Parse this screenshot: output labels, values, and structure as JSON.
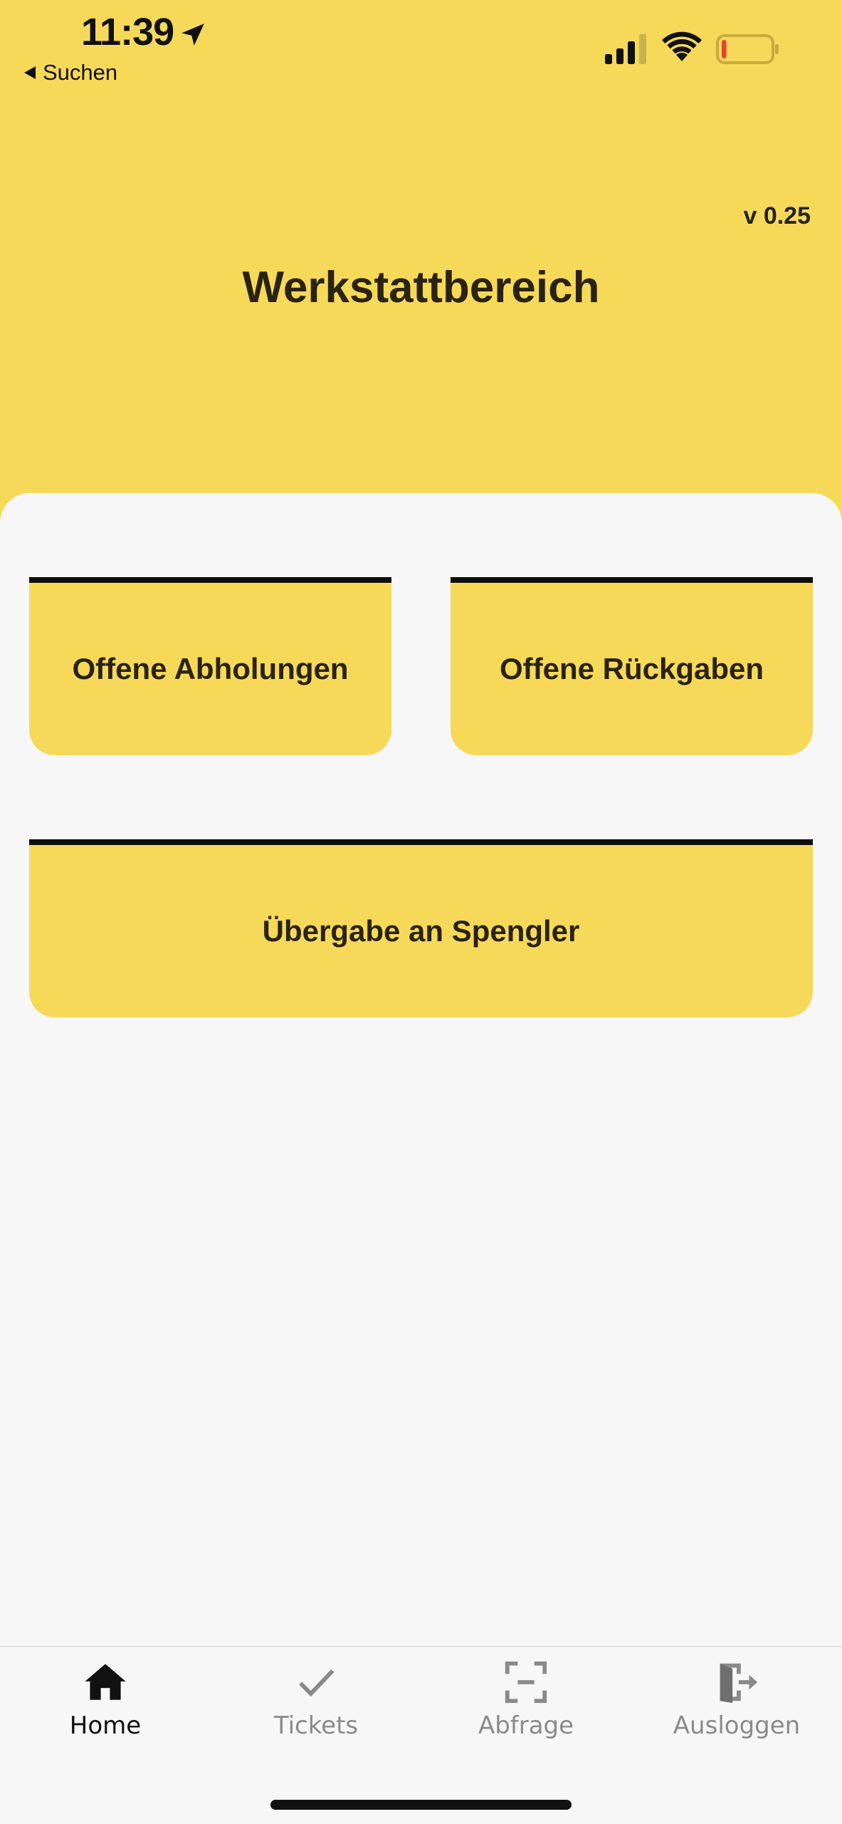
{
  "status_bar": {
    "time": "11:39",
    "back_label": "Suchen",
    "battery_level": 0.1
  },
  "header": {
    "version": "v 0.25",
    "title": "Werkstattbereich"
  },
  "tiles": [
    {
      "label": "Offene Abholungen"
    },
    {
      "label": "Offene Rückgaben"
    },
    {
      "label": "Übergabe an Spengler"
    }
  ],
  "tab_bar": {
    "tabs": [
      {
        "label": "Home",
        "icon": "home-icon",
        "active": true
      },
      {
        "label": "Tickets",
        "icon": "check-icon",
        "active": false
      },
      {
        "label": "Abfrage",
        "icon": "scan-icon",
        "active": false
      },
      {
        "label": "Ausloggen",
        "icon": "logout-icon",
        "active": false
      }
    ]
  },
  "colors": {
    "accent": "#f7d95a",
    "text": "#2a2312",
    "panel": "#f7f7f7",
    "tile_border": "#0d0d0d",
    "inactive_tab": "#8a8a8a",
    "battery_low": "#e8432f"
  }
}
